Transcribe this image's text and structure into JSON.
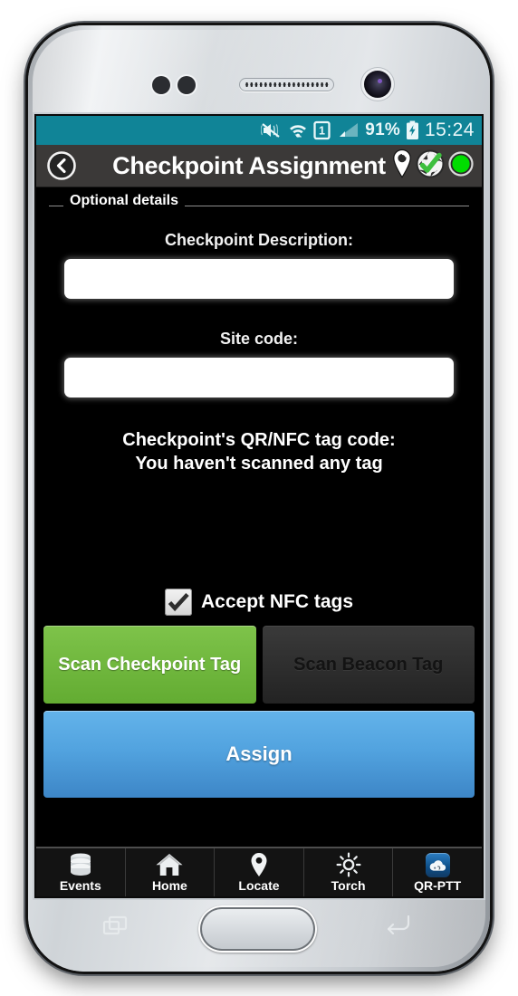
{
  "status_bar": {
    "vibrate_icon": "vibrate-mute-icon",
    "wifi_icon": "wifi-icon",
    "sim_icon": "sim-card-1-icon",
    "sim_label": "1",
    "signal_icon": "signal-bars-icon",
    "battery_percent": "91%",
    "battery_icon": "battery-charging-icon",
    "clock": "15:24",
    "background": "#108497"
  },
  "title_bar": {
    "back_icon": "back-chevron-circle-icon",
    "title": "Checkpoint Assignment",
    "icons": [
      {
        "name": "location-pin-icon"
      },
      {
        "name": "globe-check-icon"
      },
      {
        "name": "status-green-dot-icon"
      }
    ],
    "background": "#3b3938",
    "status_dot_color": "#00dd00",
    "check_color": "#3ebf3e"
  },
  "content": {
    "section_legend": "Optional details",
    "fields": [
      {
        "label": "Checkpoint Description:",
        "value": "",
        "placeholder": ""
      },
      {
        "label": "Site code:",
        "value": "",
        "placeholder": ""
      }
    ],
    "tag_code_title": "Checkpoint's QR/NFC tag code:",
    "tag_code_status": "You haven't scanned any tag",
    "nfc_checkbox": {
      "label": "Accept NFC tags",
      "checked": true,
      "check_glyph": "✔"
    },
    "buttons": {
      "scan_checkpoint": "Scan Checkpoint Tag",
      "scan_beacon": "Scan Beacon Tag",
      "assign": "Assign",
      "scan_checkpoint_color": "#6fb93e",
      "scan_beacon_color": "#2b2b2b",
      "assign_color": "#4c9cd9"
    }
  },
  "bottom_nav": {
    "items": [
      {
        "label": "Events",
        "icon": "database-stack-icon"
      },
      {
        "label": "Home",
        "icon": "home-icon"
      },
      {
        "label": "Locate",
        "icon": "map-pin-icon"
      },
      {
        "label": "Torch",
        "icon": "brightness-sun-icon"
      },
      {
        "label": "QR-PTT",
        "icon": "cloud-app-icon"
      }
    ]
  },
  "device": {
    "home_button": "home-button",
    "recents_key": "recent-apps-key",
    "back_key": "back-key",
    "front_camera": "front-camera",
    "speaker": "earpiece-speaker"
  }
}
